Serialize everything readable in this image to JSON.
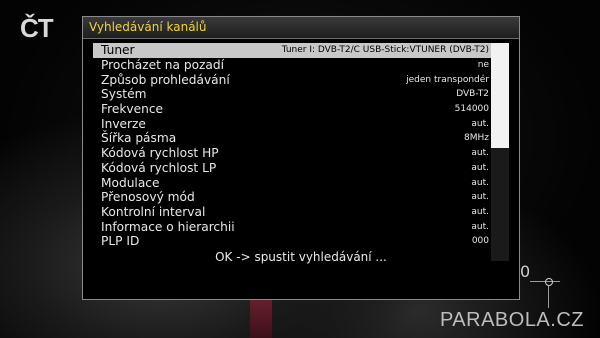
{
  "window": {
    "title": "Vyhledávání kanálů"
  },
  "rows": [
    {
      "label": "Tuner",
      "value": "Tuner I: DVB-T2/C USB-Stick:VTUNER (DVB-T2)",
      "selected": true
    },
    {
      "label": "Procházet na pozadí",
      "value": "ne"
    },
    {
      "label": "Způsob prohledávání",
      "value": "jeden transpondér"
    },
    {
      "label": "Systém",
      "value": "DVB-T2"
    },
    {
      "label": "Frekvence",
      "value": "514000"
    },
    {
      "label": "Inverze",
      "value": "aut."
    },
    {
      "label": "Šířka pásma",
      "value": "8MHz"
    },
    {
      "label": "Kódová rychlost HP",
      "value": "aut."
    },
    {
      "label": "Kódová rychlost LP",
      "value": "aut."
    },
    {
      "label": "Modulace",
      "value": "aut."
    },
    {
      "label": "Přenosový mód",
      "value": "aut."
    },
    {
      "label": "Kontrolní interval",
      "value": "aut."
    },
    {
      "label": "Informace o hierarchii",
      "value": "aut."
    },
    {
      "label": "PLP ID",
      "value": "000"
    }
  ],
  "ok_text": "OK -> spustit vyhledávání ...",
  "scrollbar": {
    "visible_fraction": 0.48
  },
  "background": {
    "channel_logo": "ČT",
    "overlay_digit": "0"
  },
  "watermark": "PARABOLA.CZ",
  "colors": {
    "title": "#f3d23a",
    "selection": "#c8c8c8"
  }
}
